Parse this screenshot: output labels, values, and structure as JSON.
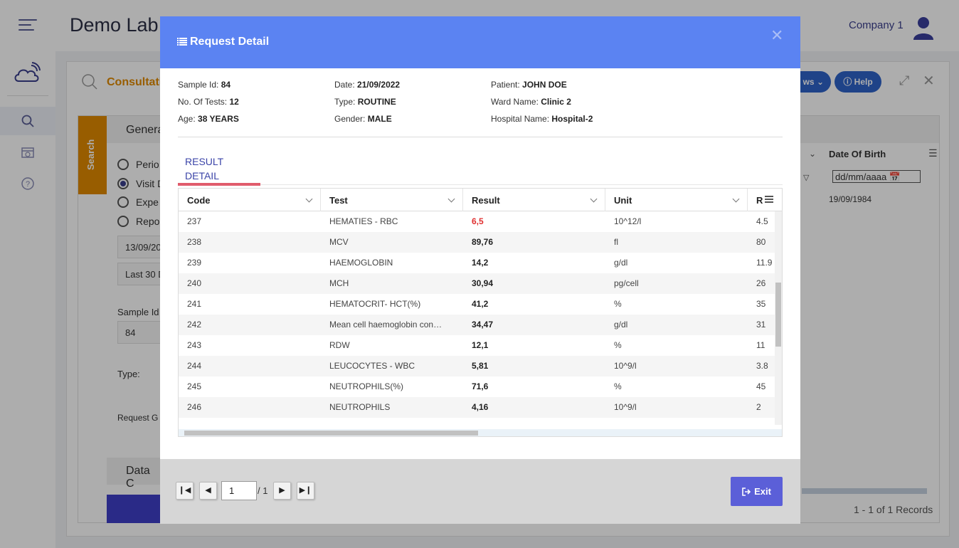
{
  "app": {
    "title": "Demo Lab",
    "company": "Company 1"
  },
  "page": {
    "title": "Consultation",
    "views_label": "ws",
    "help_label": "Help",
    "search_tab_label": "Search",
    "general_label": "Genera",
    "radio_options": [
      "Perio",
      "Visit D",
      "Expe",
      "Repo"
    ],
    "date_value": "13/09/20",
    "period_value": "Last 30 D",
    "sample_label": "Sample Id",
    "sample_value": "84",
    "type_label": "Type:",
    "request_label": "Request G",
    "data_label": "Data C",
    "dob_column": "Date Of Birth",
    "date_placeholder": "dd/mm/aaaa",
    "dob_value": "19/09/1984",
    "records": "1 - 1 of 1 Records"
  },
  "modal": {
    "title": "Request Detail",
    "info": {
      "sample_id_label": "Sample Id:",
      "sample_id": "84",
      "tests_label": "No. Of Tests:",
      "tests": "12",
      "age_label": "Age:",
      "age": "38 YEARS",
      "date_label": "Date:",
      "date": "21/09/2022",
      "type_label": "Type:",
      "type": "ROUTINE",
      "gender_label": "Gender:",
      "gender": "MALE",
      "patient_label": "Patient:",
      "patient": "JOHN DOE",
      "ward_label": "Ward Name:",
      "ward": "Clinic 2",
      "hospital_label": "Hospital Name:",
      "hospital": "Hospital-2"
    },
    "tab_label": "RESULT DETAIL",
    "columns": [
      "Code",
      "Test",
      "Result",
      "Unit",
      "R"
    ],
    "rows": [
      {
        "code": "237",
        "test": "HEMATIES - RBC",
        "result": "6,5",
        "unit": "10^12/l",
        "ref": "4.5"
      },
      {
        "code": "238",
        "test": "MCV",
        "result": "89,76",
        "unit": "fl",
        "ref": "80"
      },
      {
        "code": "239",
        "test": "HAEMOGLOBIN",
        "result": "14,2",
        "unit": "g/dl",
        "ref": "11.9"
      },
      {
        "code": "240",
        "test": "MCH",
        "result": "30,94",
        "unit": "pg/cell",
        "ref": "26"
      },
      {
        "code": "241",
        "test": "HEMATOCRIT- HCT(%)",
        "result": "41,2",
        "unit": "%",
        "ref": "35"
      },
      {
        "code": "242",
        "test": "Mean cell haemoglobin con…",
        "result": "34,47",
        "unit": "g/dl",
        "ref": "31"
      },
      {
        "code": "243",
        "test": "RDW",
        "result": "12,1",
        "unit": "%",
        "ref": "11"
      },
      {
        "code": "244",
        "test": "LEUCOCYTES - WBC",
        "result": "5,81",
        "unit": "10^9/l",
        "ref": "3.8"
      },
      {
        "code": "245",
        "test": "NEUTROPHILS(%)",
        "result": "71,6",
        "unit": "%",
        "ref": "45"
      },
      {
        "code": "246",
        "test": "NEUTROPHILS",
        "result": "4,16",
        "unit": "10^9/l",
        "ref": "2"
      }
    ],
    "pager": {
      "current": "1",
      "total": "/ 1"
    },
    "exit_label": "Exit"
  }
}
